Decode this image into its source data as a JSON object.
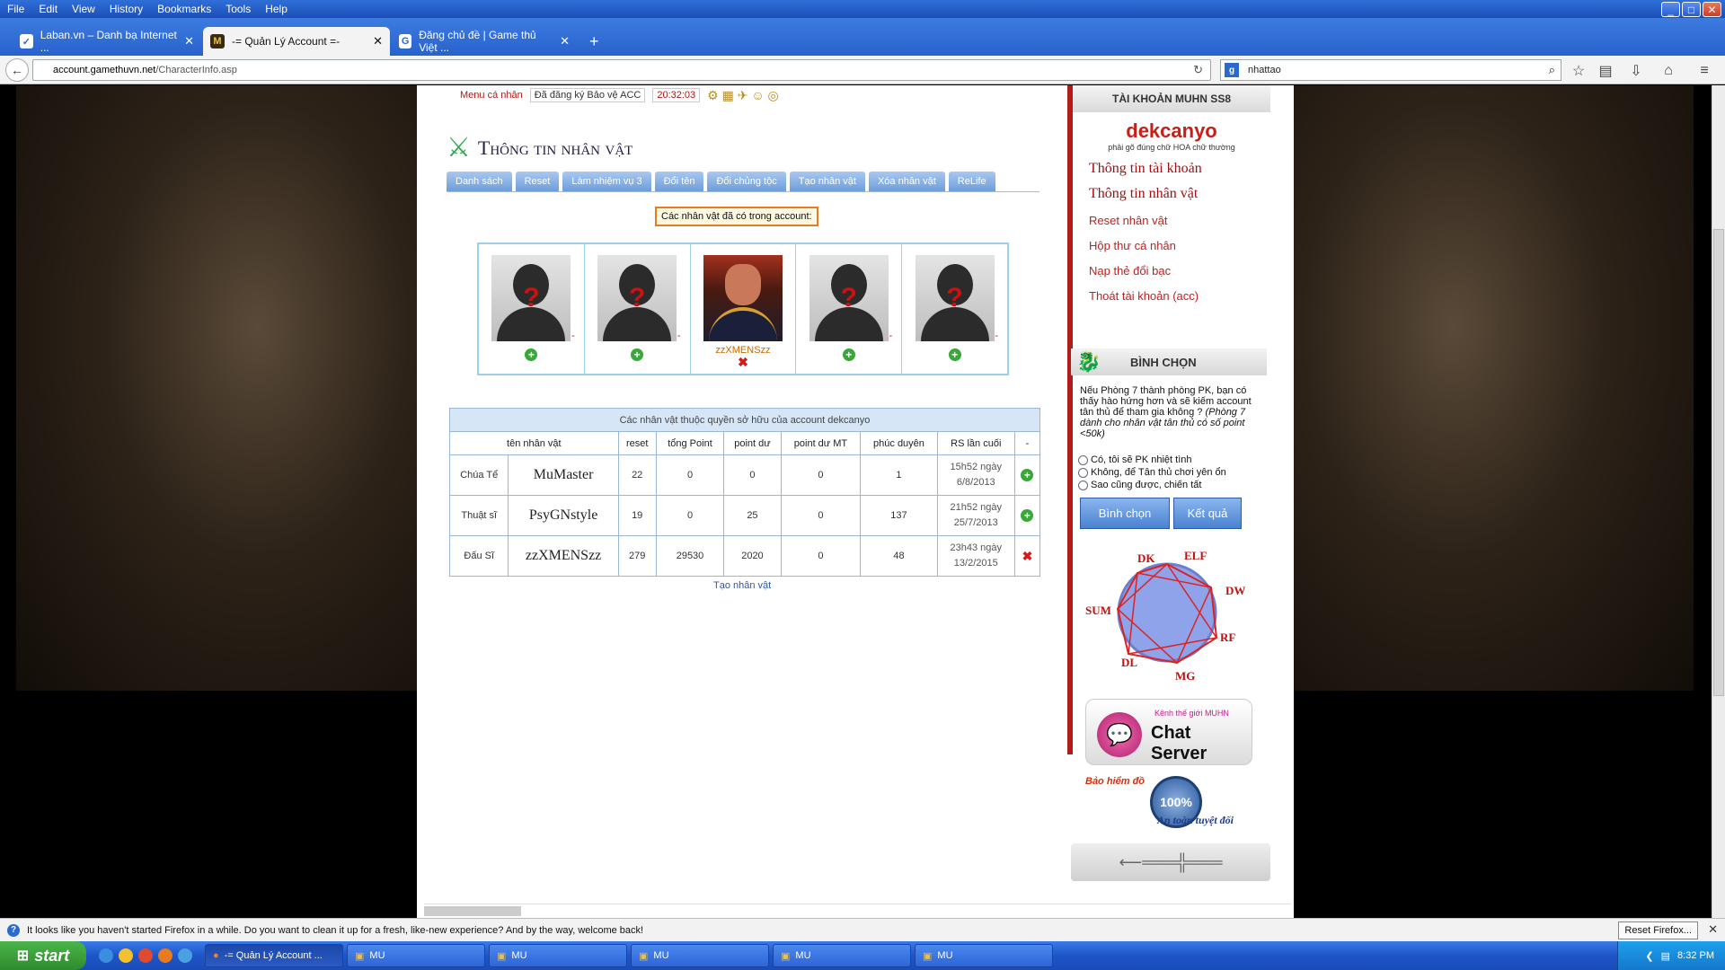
{
  "menubar": {
    "items": [
      "File",
      "Edit",
      "View",
      "History",
      "Bookmarks",
      "Tools",
      "Help"
    ]
  },
  "tabs": [
    {
      "label": "Laban.vn – Danh bạ Internet ...",
      "icon": "laban-icon"
    },
    {
      "label": "-= Quản Lý Account =-",
      "icon": "mu-icon"
    },
    {
      "label": "Đăng chủ đề | Game thủ Việt ...",
      "icon": "g-icon"
    }
  ],
  "nav": {
    "url_domain": "account.gamethuvn.net",
    "url_path": "/CharacterInfo.asp",
    "search_value": "nhattao"
  },
  "page": {
    "topstrip": {
      "menu_name": "Menu cá nhân",
      "notice": "Đã đăng ký Bảo vệ ACC",
      "time": "20:32:03"
    },
    "title": "Thông tin nhân vật",
    "subtabs": [
      "Danh sách",
      "Reset",
      "Làm nhiệm vụ 3",
      "Đổi tên",
      "Đổi chủng tộc",
      "Tạo nhân vật",
      "Xóa nhân vật",
      "ReLife"
    ],
    "slots_heading": "Các nhân vật đã có trong account:",
    "slots": [
      {
        "name": "",
        "dash": "-"
      },
      {
        "name": "",
        "dash": "-"
      },
      {
        "name": "zzXMENSzz",
        "dash": ""
      },
      {
        "name": "",
        "dash": "-"
      },
      {
        "name": "",
        "dash": "-"
      }
    ],
    "table": {
      "caption": "Các nhân vật thuộc quyền sở hữu của account dekcanyo",
      "headers": [
        "tên nhân vật",
        "reset",
        "tổng Point",
        "point dư",
        "point dư MT",
        "phúc duyên",
        "RS lần cuối",
        "-"
      ],
      "rows": [
        {
          "class": "Chúa Tể",
          "name": "MuMaster",
          "reset": "22",
          "total": "0",
          "point": "0",
          "pointmt": "0",
          "phuc": "1",
          "rs1": "15h52 ngày",
          "rs2": "6/8/2013"
        },
        {
          "class": "Thuật sĩ",
          "name": "PsyGNstyle",
          "reset": "19",
          "total": "0",
          "point": "25",
          "pointmt": "0",
          "phuc": "137",
          "rs1": "21h52 ngày",
          "rs2": "25/7/2013"
        },
        {
          "class": "Đấu Sĩ",
          "name": "zzXMENSzz",
          "reset": "279",
          "total": "29530",
          "point": "2020",
          "pointmt": "0",
          "phuc": "48",
          "rs1": "23h43 ngày",
          "rs2": "13/2/2015"
        }
      ]
    },
    "create_link": "Tạo nhân vật"
  },
  "sidebar": {
    "header": "TÀI KHOẢN MUHN SS8",
    "account": "dekcanyo",
    "account_note": "phải gõ đúng chữ HOA chữ thường",
    "links": [
      "Thông tin tài khoản",
      "Thông tin nhân vật",
      "Reset nhân vật",
      "Hộp thư cá nhân",
      "Nạp thẻ đổi bạc",
      "Thoát tài khoản (acc)"
    ],
    "vote": {
      "header": "BÌNH CHỌN",
      "question": "Nếu Phòng 7 thành phòng PK, bạn có thấy hào hứng hơn và sẽ kiếm account tân thủ để tham gia không ?",
      "note": "(Phòng 7 dành cho nhân vật tân thủ có số point <50k)",
      "options": [
        "Có, tôi sẽ PK nhiệt tình",
        "Không, để Tân thủ chơi yên ổn",
        "Sao cũng được, chiến tất"
      ],
      "vote_button": "Bình chọn",
      "result_button": "Kết quả"
    },
    "wheel": [
      "DK",
      "ELF",
      "DW",
      "RF",
      "MG",
      "DL",
      "SUM"
    ],
    "chat": {
      "small": "Kênh thế giới MUHN",
      "big": "Chat Server"
    },
    "insurance": {
      "t1": "Bảo hiểm đồ",
      "seal": "100%",
      "t2": "An toàn tuyệt đối"
    }
  },
  "notification": {
    "text": "It looks like you haven't started Firefox in a while. Do you want to clean it up for a fresh, like-new experience? And by the way, welcome back!",
    "button": "Reset Firefox..."
  },
  "taskbar": {
    "start": "start",
    "tasks": [
      "-= Quản Lý Account ...",
      "MU",
      "MU",
      "MU",
      "MU",
      "MU"
    ],
    "time": "8:32 PM"
  }
}
